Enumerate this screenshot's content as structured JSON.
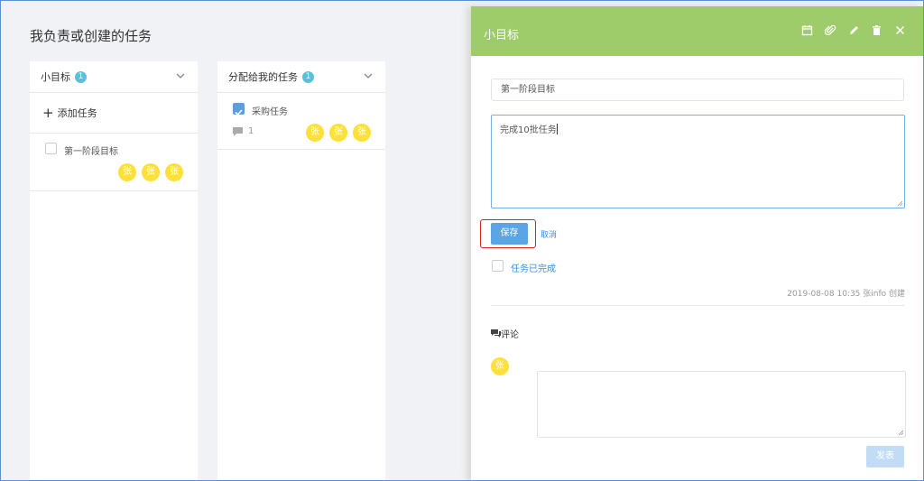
{
  "page": {
    "title": "我负责或创建的任务"
  },
  "columns": [
    {
      "name": "小目标",
      "count": "1",
      "add_task_label": "添加任务",
      "tasks": [
        {
          "name": "第一阶段目标",
          "done": false,
          "assignees": [
            "张",
            "张",
            "张"
          ]
        }
      ]
    },
    {
      "name": "分配给我的任务",
      "count": "1",
      "tasks": [
        {
          "name": "采购任务",
          "done": true,
          "comments": "1",
          "assignees": [
            "张",
            "张",
            "张"
          ]
        }
      ]
    }
  ],
  "panel": {
    "title": "小目标",
    "header_icons": [
      "calendar-icon",
      "paperclip-icon",
      "pencil-icon",
      "trash-icon",
      "close-icon"
    ],
    "task_title_value": "第一阶段目标",
    "description_value": "完成10批任务",
    "save_label": "保存",
    "cancel_label": "取消",
    "complete_label": "任务已完成",
    "meta": "2019-08-08 10:35 张info 创建",
    "comments_heading": "评论",
    "comment_avatar": "张",
    "publish_label": "发表"
  },
  "colors": {
    "header_green": "#9fcc6a",
    "primary_blue": "#5ba4e6",
    "link_blue": "#3a8ee6",
    "avatar_yellow": "#fde03a",
    "badge_blue": "#5bc0de",
    "highlight_red": "#e02020"
  }
}
